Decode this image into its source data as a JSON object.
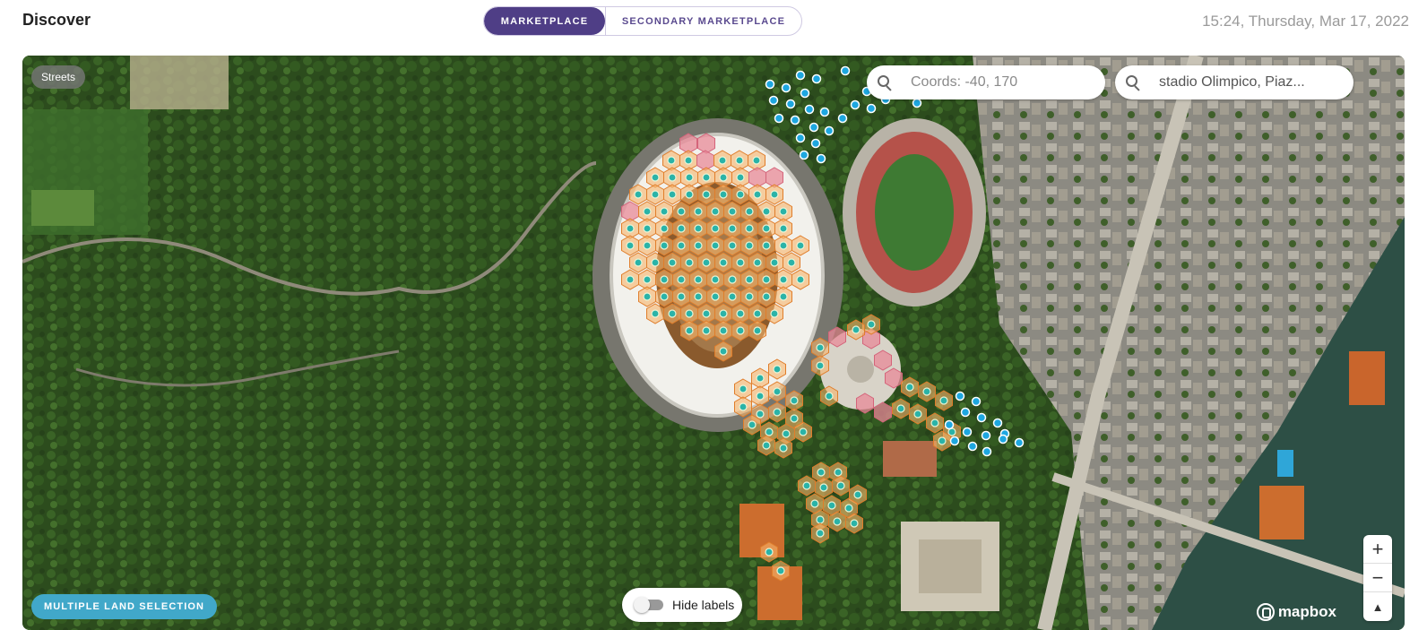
{
  "header": {
    "title": "Discover",
    "tabs": [
      {
        "label": "MARKETPLACE",
        "active": true
      },
      {
        "label": "SECONDARY MARKETPLACE",
        "active": false
      }
    ],
    "datetime": "15:24, Thursday, Mar 17, 2022"
  },
  "map": {
    "style_button": "Streets",
    "coords_search": {
      "placeholder": "Coords: -40, 170",
      "value": ""
    },
    "place_search": {
      "value": "stadio Olimpico, Piaz..."
    },
    "multi_select_button": "MULTIPLE LAND SELECTION",
    "hide_labels": {
      "label": "Hide labels",
      "enabled": false
    },
    "zoom": {
      "in": "+",
      "out": "−",
      "compass": "▲"
    },
    "attribution": "mapbox"
  },
  "colors": {
    "accent": "#4f3e86",
    "multi_select": "#41a8c9",
    "parcel_available": "#f6b46a",
    "parcel_taken": "#e88a98",
    "marker_dot": "#2ab3a8",
    "blue_dot": "#1ea7e0"
  }
}
